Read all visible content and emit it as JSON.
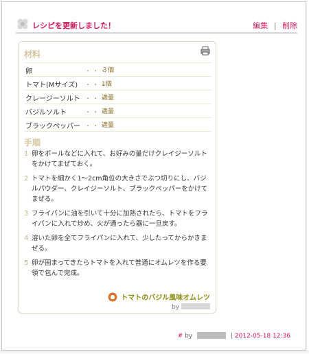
{
  "header": {
    "title": "レシピを更新しました！",
    "links": [
      "編集",
      "削除"
    ],
    "separator": "|"
  },
  "ingredients": {
    "title": "材料",
    "rows": [
      {
        "name": "卵",
        "dots": "・・・",
        "qty": "３個"
      },
      {
        "name": "トマト(Mサイズ)",
        "dots": "・・・",
        "qty": "1個"
      },
      {
        "name": "クレージーソルト",
        "dots": "・・・",
        "qty": "適量"
      },
      {
        "name": "バジルソルト",
        "dots": "・・・",
        "qty": "適量"
      },
      {
        "name": "ブラックペッパー",
        "dots": "・・・",
        "qty": "適量"
      }
    ]
  },
  "steps": {
    "title": "手順",
    "items": [
      {
        "num": "1",
        "text": "卵をボールなどに入れて、お好みの量だけクレイジーソルトをかけてまぜておく。"
      },
      {
        "num": "2",
        "text": "トマトを細かく1～2cm角位の大きさでぶつ切りにし、バジルパウダー、クレイジーソルト、ブラックペッパーをかけてまぜる。"
      },
      {
        "num": "3",
        "text": "フライパンに油を引いて十分に加熱されたら、トマトをフライパンに入れて炒め、火が通ったら器に一旦戻す。"
      },
      {
        "num": "4",
        "text": "溶いた卵を全てフライパンに入れて、少したってからかきまぜる。"
      },
      {
        "num": "5",
        "text": "卵が固まってきたらトマトを入れて普通にオムレツを作る要領で包んで完成。"
      }
    ]
  },
  "recipe": {
    "name": "トマトのバジル風味オムレツ",
    "by_label": "by"
  },
  "footer": {
    "hash": "#",
    "by_label": "by",
    "separator": "|",
    "date": "2012-05-18 12:36"
  },
  "icons": {
    "brand": "flower-icon",
    "print": "printer-icon",
    "recipe": "chef-hat-icon"
  },
  "colors": {
    "accent": "#d51a5c",
    "section": "#d8c7a0",
    "recipe_link": "#8e8f11"
  }
}
